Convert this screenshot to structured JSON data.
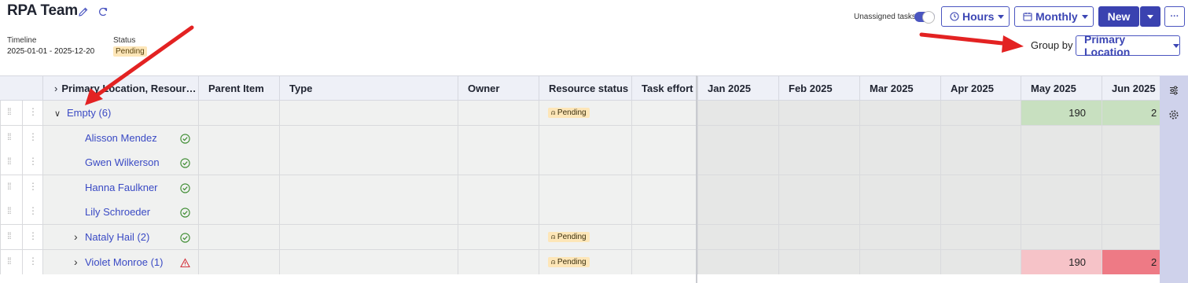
{
  "header": {
    "title": "RPA Team",
    "timeline_label": "Timeline",
    "timeline_value": "2025-01-01 - 2025-12-20",
    "status_label": "Status",
    "status_value": "Pending"
  },
  "toolbar": {
    "unassigned_label": "Unassigned tasks",
    "hours_label": "Hours",
    "monthly_label": "Monthly",
    "new_label": "New",
    "more_label": "···",
    "groupby_label": "Group by",
    "groupby_value": "Primary Location"
  },
  "columns": {
    "primary": "Primary Location, Resour…",
    "parent": "Parent Item",
    "type": "Type",
    "owner": "Owner",
    "resource_status": "Resource status",
    "task_effort": "Task effort",
    "months": [
      "Jan 2025",
      "Feb 2025",
      "Mar 2025",
      "Apr 2025",
      "May 2025",
      "Jun 2025"
    ]
  },
  "rows": [
    {
      "label": "Empty (6)",
      "status": "Pending",
      "icon": "none",
      "may": "190",
      "jun": "2"
    },
    {
      "label": "Alisson Mendez",
      "status": "",
      "icon": "check-circle-icon"
    },
    {
      "label": "Gwen Wilkerson",
      "status": "",
      "icon": "check-circle-icon"
    },
    {
      "label": "Hanna Faulkner",
      "status": "",
      "icon": "check-circle-icon"
    },
    {
      "label": "Lily Schroeder",
      "status": "",
      "icon": "check-circle-icon"
    },
    {
      "label": "Nataly Hail (2)",
      "status": "Pending",
      "icon": "check-circle-icon"
    },
    {
      "label": "Violet Monroe (1)",
      "status": "Pending",
      "icon": "warning-icon",
      "may": "190",
      "jun": "2"
    }
  ],
  "colors": {
    "accent": "#3a42b0",
    "pending_bg": "#fde6b8",
    "may_green": "#c8e0c0",
    "may_pink": "#f6c3c8",
    "jun_red": "#ee7a85",
    "arrow_red": "#e32222"
  }
}
